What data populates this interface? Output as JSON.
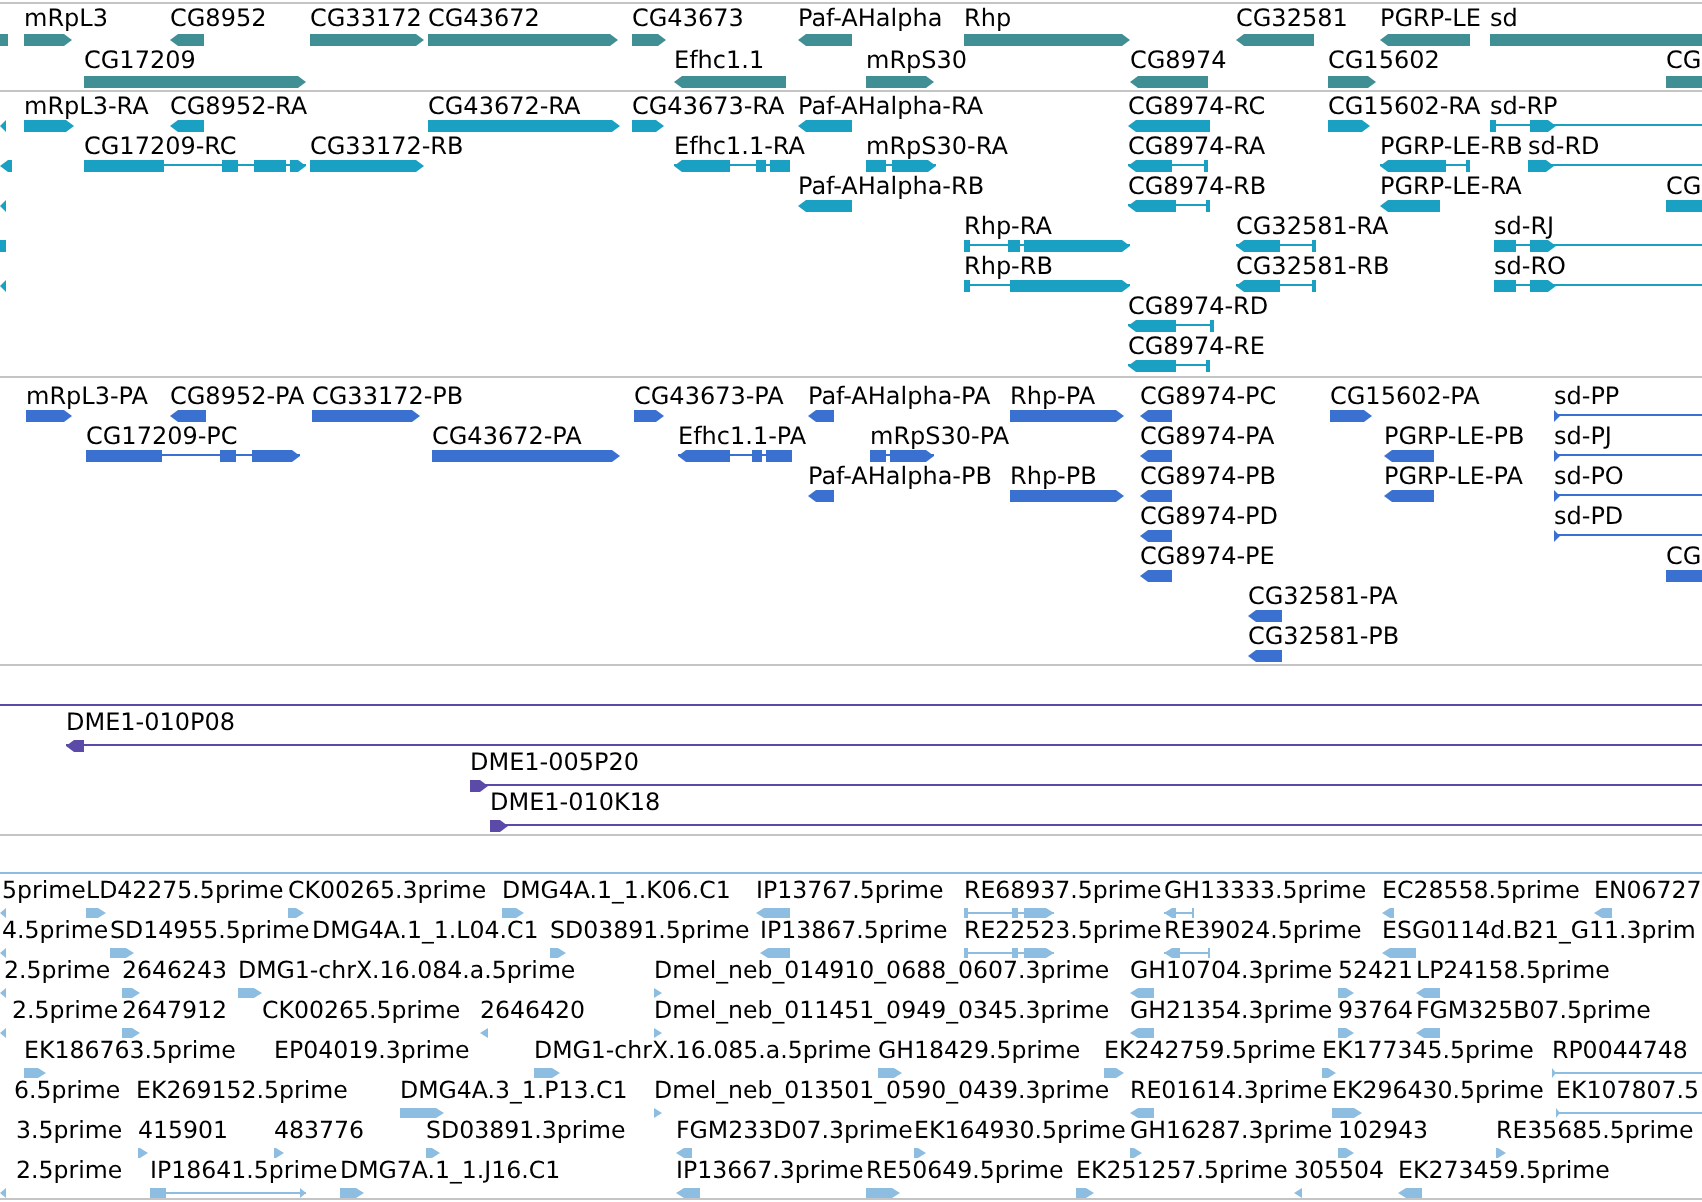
{
  "tracks": [
    {
      "kind": "gene",
      "features": [
        {
          "forward": false
        },
        {
          "label": "mRpL3",
          "forward": true
        },
        {
          "label": "CG8952",
          "forward": false
        },
        {
          "label": "CG33172",
          "forward": true
        },
        {
          "label": "CG43672",
          "forward": true
        },
        {
          "label": "CG43673",
          "forward": true
        },
        {
          "label": "Paf-AHalpha",
          "forward": false
        },
        {
          "label": "Rhp",
          "forward": true
        },
        {
          "label": "CG32581",
          "forward": false
        },
        {
          "label": "PGRP-LE",
          "forward": false
        },
        {
          "label": "sd"
        },
        {
          "label": "CG17209",
          "forward": true
        },
        {
          "label": "Efhc1.1",
          "forward": false
        },
        {
          "label": "mRpS30",
          "forward": true
        },
        {
          "label": "CG8974",
          "forward": false
        },
        {
          "label": "CG15602",
          "forward": true
        },
        {
          "label": "CG"
        }
      ]
    },
    {
      "kind": "transcript",
      "features": [
        {
          "forward": false
        },
        {
          "label": "mRpL3-RA",
          "forward": true
        },
        {
          "label": "CG8952-RA",
          "forward": false
        },
        {
          "label": "CG43672-RA",
          "forward": true
        },
        {
          "label": "CG43673-RA",
          "forward": true
        },
        {
          "label": "Paf-AHalpha-RA",
          "forward": false
        },
        {
          "label": "CG8974-RC",
          "forward": false
        },
        {
          "label": "CG15602-RA",
          "forward": true
        },
        {
          "label": "sd-RP",
          "forward": true
        },
        {
          "forward": false
        },
        {
          "label": "CG17209-RC",
          "forward": true
        },
        {
          "label": "CG33172-RB",
          "forward": true
        },
        {
          "label": "Efhc1.1-RA",
          "forward": false
        },
        {
          "label": "mRpS30-RA",
          "forward": true
        },
        {
          "label": "CG8974-RA",
          "forward": false
        },
        {
          "label": "PGRP-LE-RB",
          "forward": false
        },
        {
          "label": "sd-RD",
          "forward": true
        },
        {
          "forward": false
        },
        {
          "label": "Paf-AHalpha-RB",
          "forward": false
        },
        {
          "label": "CG8974-RB",
          "forward": false
        },
        {
          "label": "PGRP-LE-RA",
          "forward": false
        },
        {
          "label": "CG"
        },
        {
          "forward": false
        },
        {
          "label": "Rhp-RA",
          "forward": true
        },
        {
          "label": "CG32581-RA",
          "forward": false
        },
        {
          "label": "sd-RJ",
          "forward": true
        },
        {
          "forward": false
        },
        {
          "label": "Rhp-RB",
          "forward": true
        },
        {
          "label": "CG32581-RB",
          "forward": false
        },
        {
          "label": "sd-RO",
          "forward": true
        },
        {
          "label": "CG8974-RD",
          "forward": false
        },
        {
          "label": "CG8974-RE",
          "forward": false
        }
      ]
    },
    {
      "kind": "protein",
      "features": [
        {
          "label": "mRpL3-PA",
          "forward": true
        },
        {
          "label": "CG8952-PA",
          "forward": false
        },
        {
          "label": "CG33172-PB",
          "forward": true
        },
        {
          "label": "CG43673-PA",
          "forward": true
        },
        {
          "label": "Paf-AHalpha-PA",
          "forward": false
        },
        {
          "label": "Rhp-PA",
          "forward": true
        },
        {
          "label": "CG8974-PC",
          "forward": false
        },
        {
          "label": "CG15602-PA",
          "forward": true
        },
        {
          "label": "sd-PP",
          "forward": true
        },
        {
          "label": "CG17209-PC",
          "forward": true
        },
        {
          "label": "CG43672-PA",
          "forward": true
        },
        {
          "label": "Efhc1.1-PA",
          "forward": false
        },
        {
          "label": "mRpS30-PA",
          "forward": true
        },
        {
          "label": "CG8974-PA",
          "forward": false
        },
        {
          "label": "PGRP-LE-PB",
          "forward": false
        },
        {
          "label": "sd-PJ",
          "forward": true
        },
        {
          "label": "Paf-AHalpha-PB",
          "forward": false
        },
        {
          "label": "Rhp-PB",
          "forward": true
        },
        {
          "label": "CG8974-PB",
          "forward": false
        },
        {
          "label": "PGRP-LE-PA",
          "forward": false
        },
        {
          "label": "sd-PO",
          "forward": true
        },
        {
          "label": "CG8974-PD",
          "forward": false
        },
        {
          "label": "sd-PD",
          "forward": true
        },
        {
          "label": "CG8974-PE",
          "forward": false
        },
        {
          "label": "CG"
        },
        {
          "label": "CG32581-PA",
          "forward": false
        },
        {
          "label": "CG32581-PB",
          "forward": false
        }
      ]
    },
    {
      "kind": "clone",
      "features": [
        {
          "clipped": true
        },
        {
          "label": "DME1-010P08",
          "forward": false
        },
        {
          "label": "DME1-005P20",
          "forward": true
        },
        {
          "label": "DME1-010K18",
          "forward": true
        }
      ]
    },
    {
      "kind": "est",
      "features": [
        {
          "clipped": true
        },
        {
          "label": "5prime",
          "forward": false
        },
        {
          "label": "LD42275.5prime",
          "forward": true
        },
        {
          "label": "CK00265.3prime",
          "forward": true
        },
        {
          "label": "DMG4A.1_1.K06.C1",
          "forward": true
        },
        {
          "label": "IP13767.5prime",
          "forward": false
        },
        {
          "label": "RE68937.5prime",
          "forward": true
        },
        {
          "label": "GH13333.5prime",
          "forward": false
        },
        {
          "label": "EC28558.5prime",
          "forward": false
        },
        {
          "label": "EN06727",
          "forward": false
        },
        {
          "label": "4.5prime",
          "forward": false
        },
        {
          "label": "SD14955.5prime",
          "forward": true
        },
        {
          "label": "DMG4A.1_1.L04.C1"
        },
        {
          "label": "SD03891.5prime",
          "forward": true
        },
        {
          "label": "IP13867.5prime",
          "forward": false
        },
        {
          "label": "RE22523.5prime",
          "forward": true
        },
        {
          "label": "RE39024.5prime",
          "forward": false
        },
        {
          "label": "ESG0114d.B21_G11.3prim",
          "forward": false
        },
        {
          "label": "2.5prime",
          "forward": false
        },
        {
          "label": "2646243",
          "forward": true
        },
        {
          "label": "DMG1-chrX.16.084.a.5prime",
          "forward": true
        },
        {
          "label": "Dmel_neb_014910_0688_0607.3prime",
          "forward": true
        },
        {
          "label": "GH10704.3prime",
          "forward": false
        },
        {
          "label": "52421",
          "forward": true
        },
        {
          "label": "LP24158.5prime",
          "forward": false
        },
        {
          "label": "2.5prime",
          "forward": false
        },
        {
          "label": "2647912",
          "forward": true
        },
        {
          "label": "CK00265.5prime"
        },
        {
          "label": "2646420",
          "forward": false
        },
        {
          "label": "Dmel_neb_011451_0949_0345.3prime",
          "forward": true
        },
        {
          "label": "GH21354.3prime",
          "forward": false
        },
        {
          "label": "93764",
          "forward": true
        },
        {
          "label": "FGM325B07.5prime",
          "forward": false
        },
        {
          "label": "EK186763.5prime",
          "forward": true
        },
        {
          "label": "EP04019.3prime"
        },
        {
          "label": "DMG1-chrX.16.085.a.5prime",
          "forward": true
        },
        {
          "label": "GH18429.5prime",
          "forward": true
        },
        {
          "label": "EK242759.5prime",
          "forward": true
        },
        {
          "label": "EK177345.5prime",
          "forward": true
        },
        {
          "label": "RP0044748",
          "forward": true
        },
        {
          "label": "6.5prime"
        },
        {
          "label": "EK269152.5prime"
        },
        {
          "label": "DMG4A.3_1.P13.C1",
          "forward": true
        },
        {
          "label": "Dmel_neb_013501_0590_0439.3prime",
          "forward": true
        },
        {
          "label": "RE01614.3prime",
          "forward": false
        },
        {
          "label": "EK296430.5prime",
          "forward": true
        },
        {
          "label": "EK107807.5",
          "forward": true
        },
        {
          "label": "3.5prime"
        },
        {
          "label": "415901",
          "forward": true
        },
        {
          "label": "483776",
          "forward": true
        },
        {
          "label": "SD03891.3prime",
          "forward": true
        },
        {
          "label": "FGM233D07.3prime",
          "forward": false
        },
        {
          "label": "EK164930.5prime",
          "forward": true
        },
        {
          "label": "GH16287.3prime",
          "forward": true
        },
        {
          "label": "102943",
          "forward": true
        },
        {
          "label": "RE35685.5prime",
          "forward": true
        },
        {
          "label": "2.5prime",
          "forward": false
        },
        {
          "label": "IP18641.5prime",
          "forward": true
        },
        {
          "label": "DMG7A.1_1.J16.C1",
          "forward": true
        },
        {
          "label": "IP13667.3prime",
          "forward": false
        },
        {
          "label": "RE50649.5prime",
          "forward": true
        },
        {
          "label": "EK251257.5prime",
          "forward": true
        },
        {
          "label": "305504",
          "forward": false
        },
        {
          "label": "EK273459.5prime",
          "forward": false
        }
      ]
    }
  ]
}
